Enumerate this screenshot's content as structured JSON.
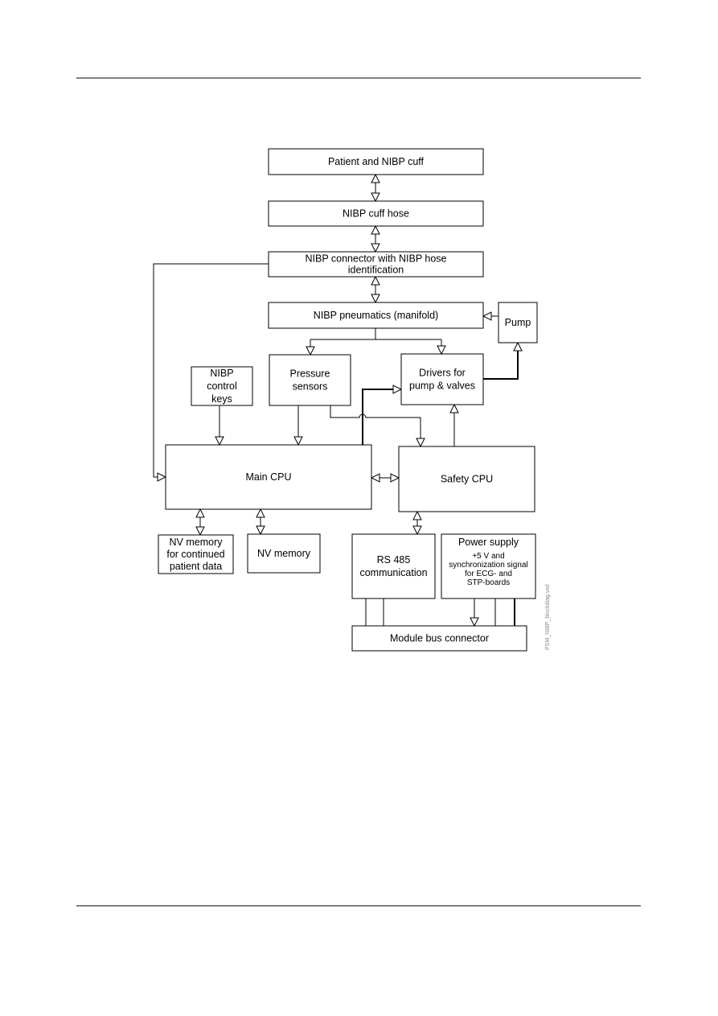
{
  "diagram": {
    "boxes": {
      "patient": [
        "Patient and NIBP cuff"
      ],
      "hose": [
        "NIBP cuff hose"
      ],
      "connector": [
        "NIBP connector with NIBP hose",
        "identification"
      ],
      "pneumatics": [
        "NIBP pneumatics (manifold)"
      ],
      "pump": [
        "Pump"
      ],
      "pressure_sensors": [
        "Pressure",
        "sensors"
      ],
      "drivers": [
        "Drivers for",
        "pump & valves"
      ],
      "control_keys": [
        "NIBP",
        "control",
        "keys"
      ],
      "main_cpu": [
        "Main CPU"
      ],
      "safety_cpu": [
        "Safety CPU"
      ],
      "nv_memory_patient": [
        "NV memory",
        "for continued",
        "patient data"
      ],
      "nv_memory": [
        "NV memory"
      ],
      "rs485": [
        "RS 485",
        "communication"
      ],
      "power_supply": [
        "Power supply",
        "+5 V and",
        "synchronization signal",
        "for ECG- and",
        "STP-boards"
      ],
      "module_bus": [
        "Module bus connector"
      ]
    },
    "file_label": "PSM_NIBP_blockdiag.vsd"
  }
}
